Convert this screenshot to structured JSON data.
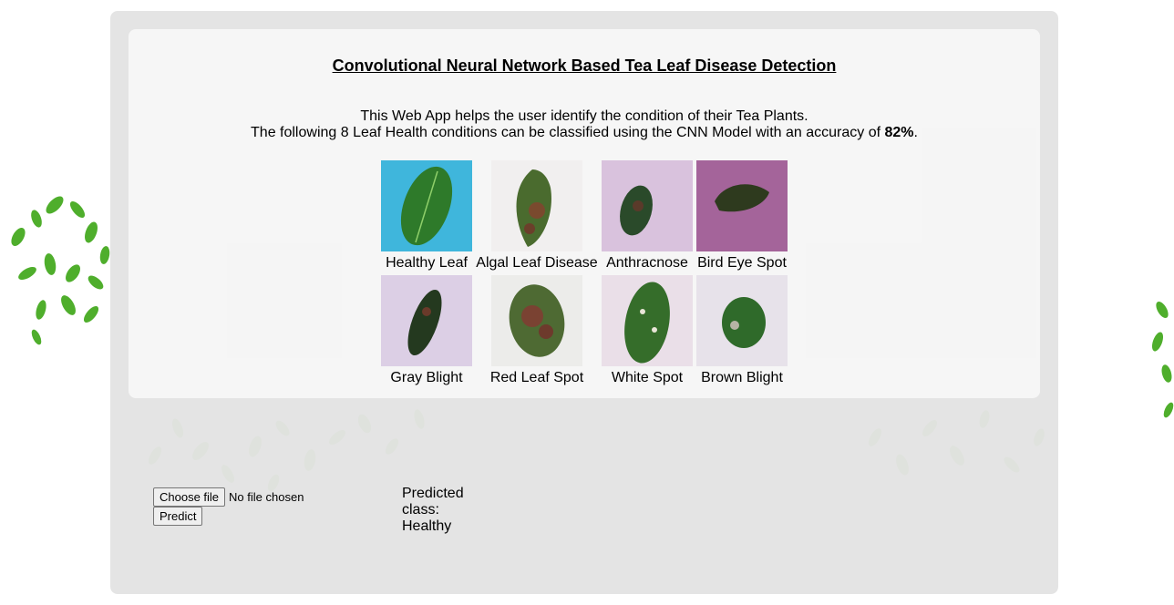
{
  "header": {
    "title": "Convolutional Neural Network Based Tea Leaf Disease Detection"
  },
  "intro": {
    "line1": "This Web App helps the user identify the condition of their Tea Plants.",
    "line2_prefix": "The following 8 Leaf Health conditions can be classified using the CNN Model with an accuracy of ",
    "accuracy": "82%",
    "line2_suffix": "."
  },
  "classes": [
    {
      "label": "Healthy Leaf",
      "bg": "#3fb6dc"
    },
    {
      "label": "Algal Leaf Disease",
      "bg": "#f1efef"
    },
    {
      "label": "Anthracnose",
      "bg": "#d9c2dd"
    },
    {
      "label": "Bird Eye Spot",
      "bg": "#a4649a"
    },
    {
      "label": "Gray Blight",
      "bg": "#dccfe5"
    },
    {
      "label": "Red Leaf Spot",
      "bg": "#ececea"
    },
    {
      "label": "White Spot",
      "bg": "#eadfe8"
    },
    {
      "label": "Brown Blight",
      "bg": "#e7e2ea"
    }
  ],
  "upload": {
    "choose_label": "Choose file",
    "status": "No file chosen",
    "predict_label": "Predict"
  },
  "result": {
    "text": "Predicted class: Healthy"
  },
  "colors": {
    "leaf": "#2f7d2a",
    "leaf_light": "#5fb336",
    "panel": "#e2e2e2",
    "card": "#f7f7f7"
  }
}
